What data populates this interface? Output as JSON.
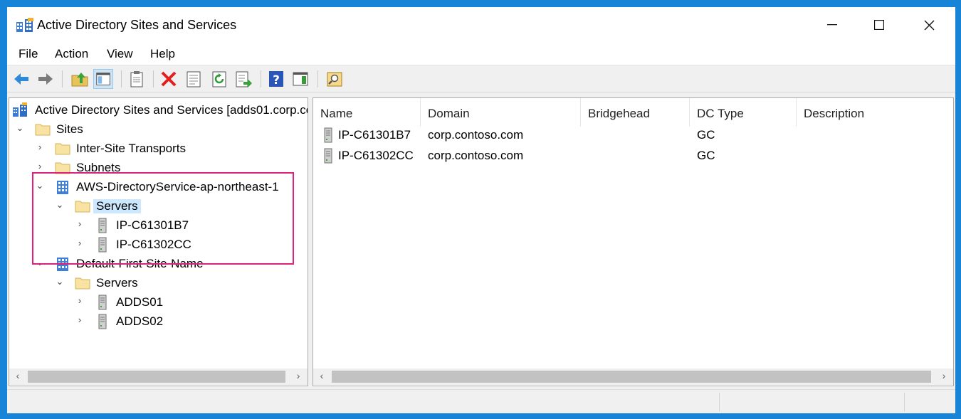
{
  "window": {
    "title": "Active Directory Sites and Services",
    "controls": {
      "minimize": "—",
      "maximize": "☐",
      "close": "✕"
    }
  },
  "menu": [
    "File",
    "Action",
    "View",
    "Help"
  ],
  "toolbar": {
    "buttons": [
      "back-icon",
      "forward-icon",
      "up-folder-icon",
      "show-hide-console-tree-icon",
      "clipboard-icon",
      "delete-icon",
      "properties-icon",
      "refresh-icon",
      "export-list-icon",
      "help-icon",
      "show-action-pane-icon",
      "find-icon"
    ]
  },
  "tree": {
    "root": "Active Directory Sites and Services [adds01.corp.cc",
    "sites": "Sites",
    "inter_site": "Inter-Site Transports",
    "subnets": "Subnets",
    "aws_site": "AWS-DirectoryService-ap-northeast-1",
    "aws_servers": "Servers",
    "aws_server_1": "IP-C61301B7",
    "aws_server_2": "IP-C61302CC",
    "default_site": "Default-First-Site-Name",
    "default_servers": "Servers",
    "default_server_1": "ADDS01",
    "default_server_2": "ADDS02"
  },
  "list": {
    "columns": [
      "Name",
      "Domain",
      "Bridgehead",
      "DC Type",
      "Description"
    ],
    "rows": [
      {
        "name": "IP-C61301B7",
        "domain": "corp.contoso.com",
        "bridgehead": "",
        "dc_type": "GC",
        "description": ""
      },
      {
        "name": "IP-C61302CC",
        "domain": "corp.contoso.com",
        "bridgehead": "",
        "dc_type": "GC",
        "description": ""
      }
    ]
  },
  "colors": {
    "desktop": "#1884d8",
    "highlight_box": "#e0207a",
    "tree_selection": "#cce8ff"
  }
}
